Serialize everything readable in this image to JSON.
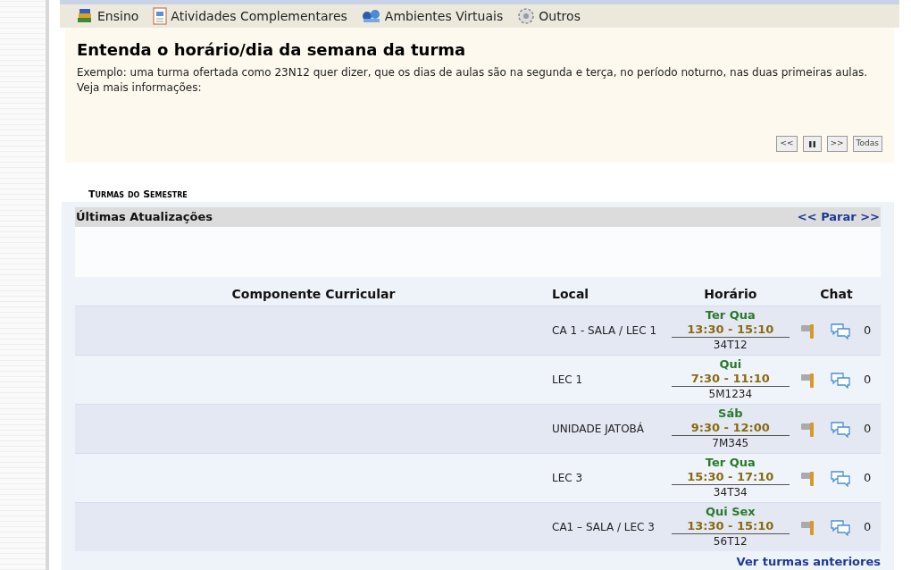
{
  "menu": [
    {
      "label": "Ensino"
    },
    {
      "label": "Atividades Complementares"
    },
    {
      "label": "Ambientes Virtuais"
    },
    {
      "label": "Outros"
    }
  ],
  "notice": {
    "title": "Entenda o horário/dia da semana da turma",
    "text": "Exemplo: uma turma ofertada como 23N12 quer dizer, que os dias de aulas são na segunda e terça, no período noturno, nas duas primeiras aulas. Veja mais informações:",
    "controls": [
      {
        "kind": "text",
        "label": "<<"
      },
      {
        "kind": "pause"
      },
      {
        "kind": "text",
        "label": ">>"
      },
      {
        "kind": "text",
        "label": "Todas"
      }
    ]
  },
  "section_title": "Turmas do Semestre",
  "updates": {
    "title": "Últimas Atualizações",
    "link": "<< Parar >>"
  },
  "table": {
    "columns": [
      "Componente Curricular",
      "Local",
      "Horário",
      "Chat"
    ],
    "rows": [
      {
        "local": "CA 1 - SALA / LEC 1",
        "days": "Ter Qua",
        "time": "13:30 - 15:10",
        "code": "34T12",
        "chat_count": "0"
      },
      {
        "local": "LEC 1",
        "days": "Qui",
        "time": "7:30 - 11:10",
        "code": "5M1234",
        "chat_count": "0"
      },
      {
        "local": "UNIDADE JATOBÁ",
        "days": "Sáb",
        "time": "9:30 - 12:00",
        "code": "7M345",
        "chat_count": "0"
      },
      {
        "local": "LEC 3",
        "days": "Ter Qua",
        "time": "15:30 - 17:10",
        "code": "34T34",
        "chat_count": "0"
      },
      {
        "local": "CA1 – SALA / LEC 3",
        "days": "Qui Sex",
        "time": "13:30 - 15:10",
        "code": "56T12",
        "chat_count": "0"
      }
    ]
  },
  "footer_link": "Ver turmas anteriores"
}
